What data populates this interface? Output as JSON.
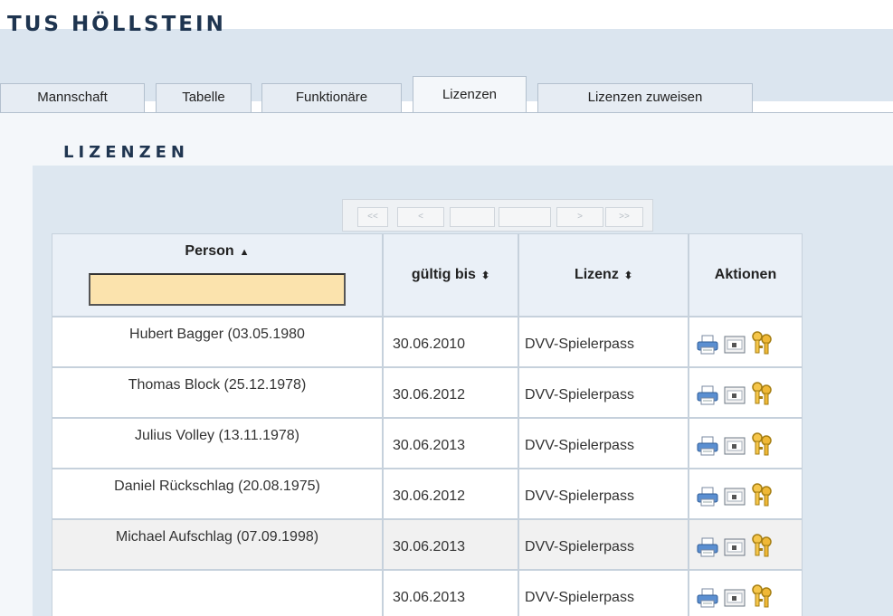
{
  "site": {
    "title": "TuS Höllstein"
  },
  "tabs": [
    {
      "label": "Mannschaft"
    },
    {
      "label": "Tabelle"
    },
    {
      "label": "Funktionäre"
    },
    {
      "label": "Lizenzen",
      "active": true
    },
    {
      "label": "Lizenzen zuweisen"
    }
  ],
  "section": {
    "title": "Lizenzen"
  },
  "pager": {
    "first": "<<",
    "prev": "<",
    "next": ">",
    "last": ">>"
  },
  "table": {
    "headers": {
      "person": "Person",
      "valid_until": "gültig bis",
      "license": "Lizenz",
      "actions": "Aktionen"
    },
    "sort_icons": {
      "person": "▲",
      "valid_until": "⬍",
      "license": "⬍"
    },
    "filter": {
      "value": ""
    },
    "rows": [
      {
        "person": "Hubert Bagger (03.05.1980",
        "valid_until": "30.06.2010",
        "license": "DVV-Spielerpass"
      },
      {
        "person": "Thomas Block (25.12.1978)",
        "valid_until": "30.06.2012",
        "license": "DVV-Spielerpass"
      },
      {
        "person": "Julius Volley (13.11.1978)",
        "valid_until": "30.06.2013",
        "license": "DVV-Spielerpass"
      },
      {
        "person": "Daniel Rückschlag (20.08.1975)",
        "valid_until": "30.06.2012",
        "license": "DVV-Spielerpass"
      },
      {
        "person": "Michael Aufschlag (07.09.1998)",
        "valid_until": "30.06.2013",
        "license": "DVV-Spielerpass"
      },
      {
        "person": "",
        "valid_until": "30.06.2013",
        "license": "DVV-Spielerpass"
      }
    ],
    "action_icons": [
      "printer-icon",
      "card-icon",
      "keys-icon"
    ]
  },
  "colors": {
    "title": "#1f3550",
    "band": "#dbe5ef",
    "panel": "#f4f7fa",
    "content": "#dde7f0",
    "filter_bg": "#fbe3ad",
    "header_bg": "#eaf0f7"
  }
}
